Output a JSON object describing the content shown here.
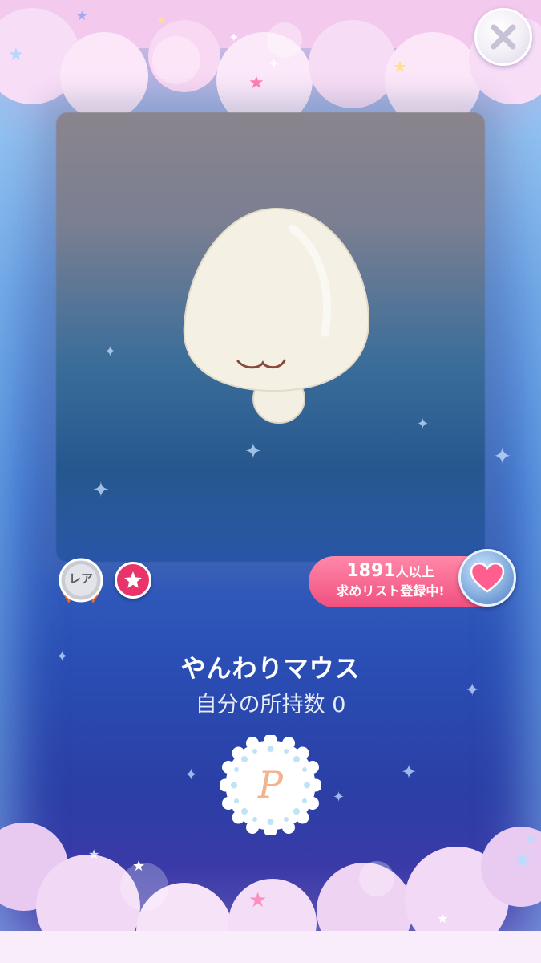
{
  "item": {
    "name": "やんわりマウス",
    "owned_label": "自分の所持数",
    "owned_count": "0",
    "rarity_label": "レア"
  },
  "wishlist": {
    "count": "1891",
    "count_suffix": "人以上",
    "caption": "求めリスト登録中!"
  },
  "p_badge": {
    "letter": "P"
  },
  "colors": {
    "accent_pink": "#f0507e",
    "star_badge": "#e8346b",
    "sky_dark": "#2a4fb5"
  },
  "icons": {
    "close": "close-x-icon",
    "heart": "heart-icon",
    "star": "star-icon",
    "rarity": "silver-medal-icon"
  }
}
